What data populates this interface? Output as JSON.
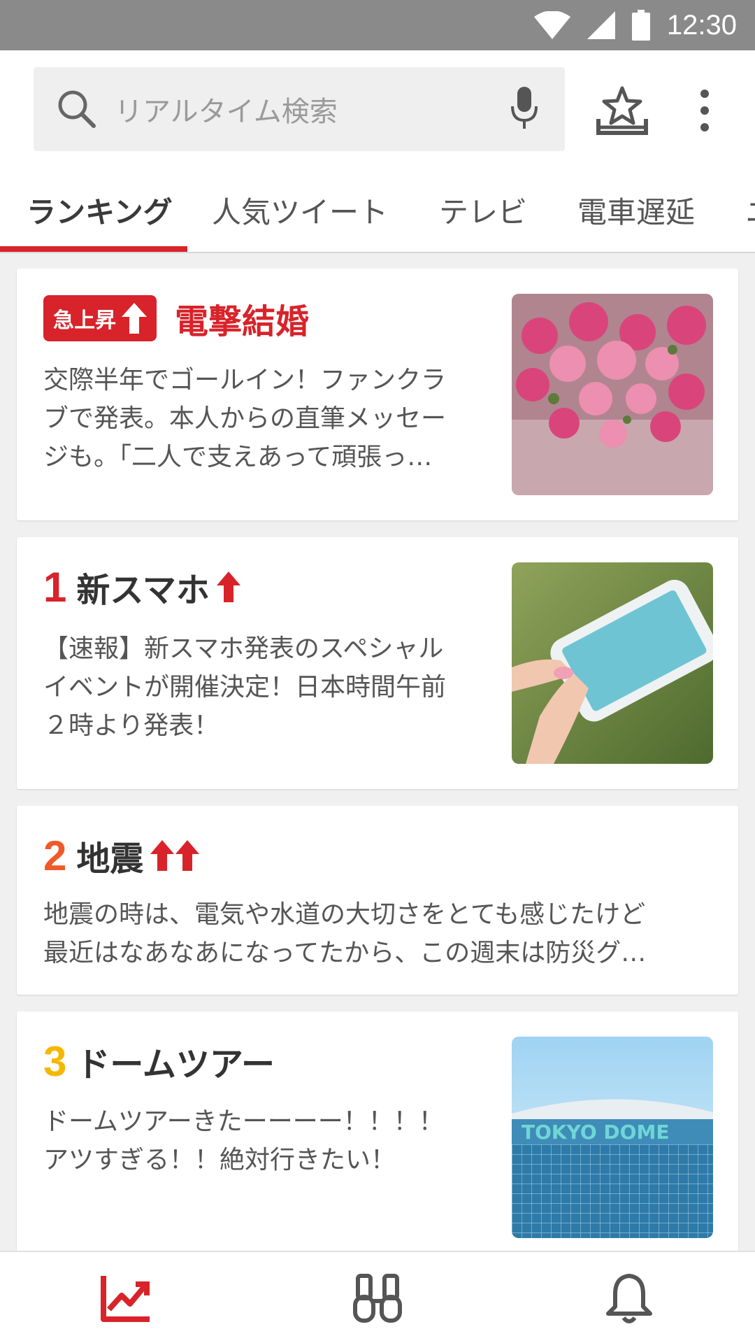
{
  "status_bar": {
    "time": "12:30",
    "icons": [
      "wifi-icon",
      "cellular-icon",
      "battery-icon"
    ]
  },
  "search": {
    "placeholder": "リアルタイム検索"
  },
  "header_icons": [
    "search-icon",
    "mic-icon",
    "tray-star-icon",
    "more-vert-icon"
  ],
  "tabs": [
    {
      "label": "ランキング",
      "active": true
    },
    {
      "label": "人気ツイート",
      "active": false
    },
    {
      "label": "テレビ",
      "active": false
    },
    {
      "label": "電車遅延",
      "active": false
    },
    {
      "label": "ニ",
      "active": false
    }
  ],
  "cards": [
    {
      "badge": "急上昇",
      "title": "電撃結婚",
      "desc_lines": [
        "交際半年でゴールイン！ファンクラ",
        "ブで発表。本人からの直筆メッセー",
        "ジも。「二人で支えあって頑張っ…"
      ],
      "image": "bouquet-of-pink-roses"
    },
    {
      "rank": "1",
      "title": "新スマホ",
      "arrows": 1,
      "desc_lines": [
        "【速報】新スマホ発表のスペシャル",
        "イベントが開催決定！日本時間午前",
        "２時より発表！"
      ],
      "image": "hand-holding-smartphone"
    },
    {
      "rank": "2",
      "title": "地震",
      "arrows": 2,
      "desc_lines": [
        "地震の時は、電気や水道の大切さをとても感じたけど",
        "最近はなあなあになってたから、この週末は防災グ…"
      ]
    },
    {
      "rank": "3",
      "title": "ドームツアー",
      "desc_lines": [
        "ドームツアーきたーーーー！！！！",
        "アツすぎる！！絶対行きたい！"
      ],
      "image": "tokyo-dome",
      "image_text": "TOKYO DOME"
    }
  ],
  "colors": {
    "accent": "#d8232a",
    "rank1": "#d8232a",
    "rank2": "#f05a28",
    "rank3": "#f5b800"
  },
  "bottom_nav": [
    {
      "icon": "trending-chart-icon",
      "active": true
    },
    {
      "icon": "binoculars-icon",
      "active": false
    },
    {
      "icon": "bell-icon",
      "active": false
    }
  ]
}
